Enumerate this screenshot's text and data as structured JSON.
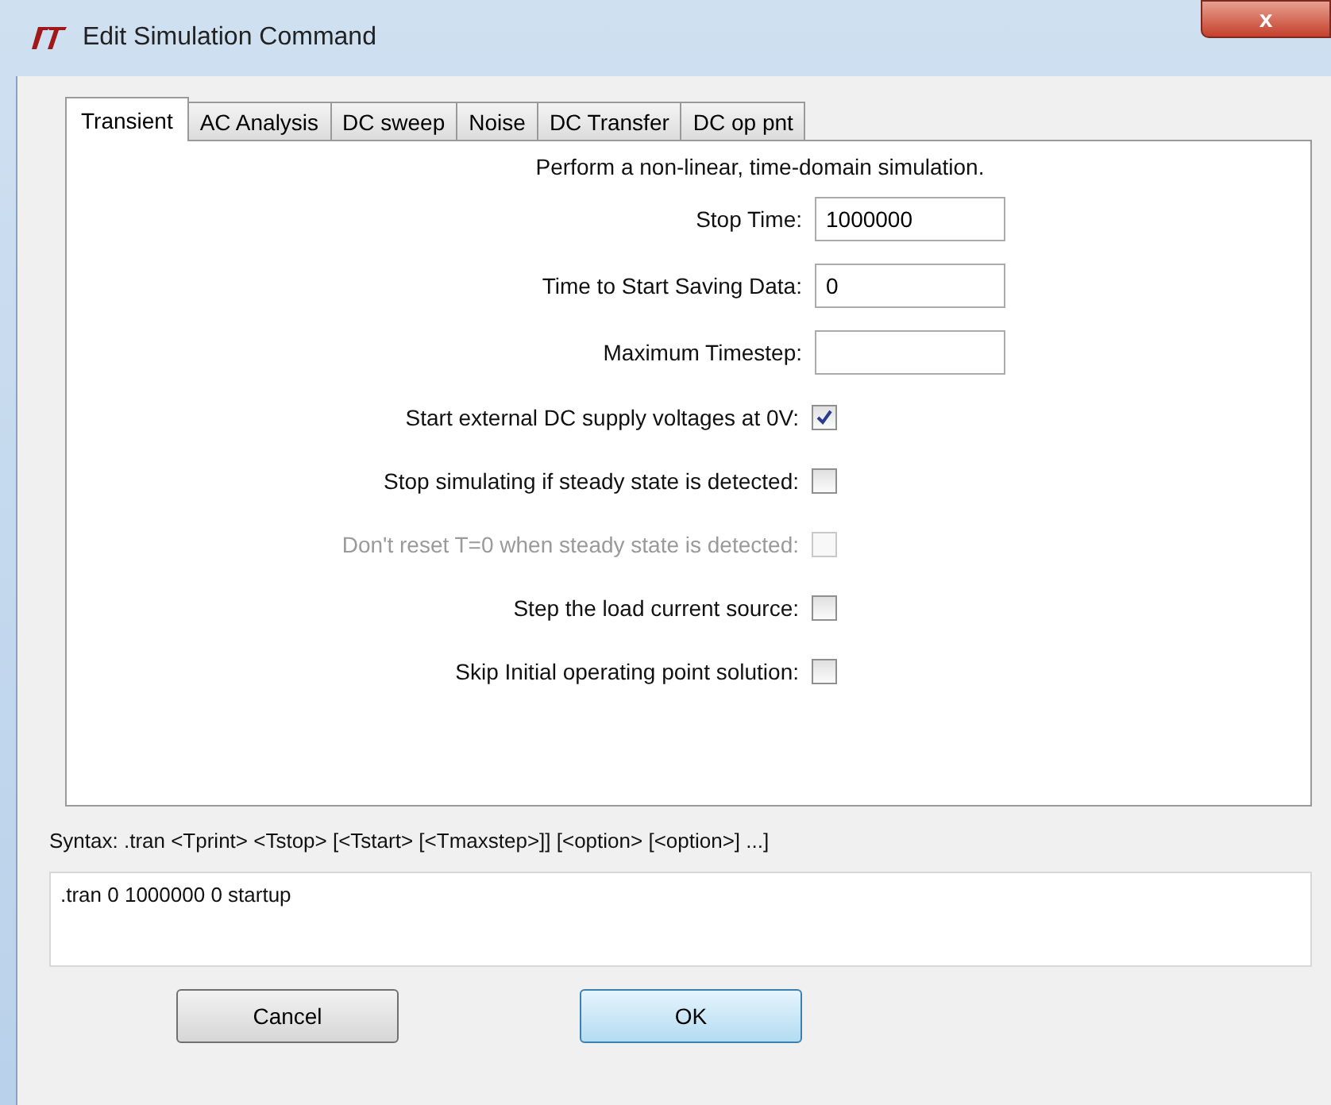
{
  "window": {
    "title": "Edit Simulation Command",
    "close": "x"
  },
  "tabs": [
    {
      "label": "Transient",
      "selected": true
    },
    {
      "label": "AC Analysis",
      "selected": false
    },
    {
      "label": "DC sweep",
      "selected": false
    },
    {
      "label": "Noise",
      "selected": false
    },
    {
      "label": "DC Transfer",
      "selected": false
    },
    {
      "label": "DC op pnt",
      "selected": false
    }
  ],
  "description": "Perform a non-linear, time-domain simulation.",
  "fields": [
    {
      "label": "Stop Time:",
      "value": "1000000"
    },
    {
      "label": "Time to Start Saving Data:",
      "value": "0"
    },
    {
      "label": "Maximum Timestep:"
    }
  ],
  "options": [
    {
      "label": "Start external DC supply voltages at 0V:",
      "checked": true,
      "disabled": false
    },
    {
      "label": "Stop simulating if steady state is detected:",
      "checked": false,
      "disabled": false
    },
    {
      "label": "Don't reset T=0 when steady state is detected:",
      "checked": false,
      "disabled": true
    },
    {
      "label": "Step the load current source:",
      "checked": false,
      "disabled": false
    },
    {
      "label": "Skip Initial operating point solution:",
      "checked": false,
      "disabled": false
    }
  ],
  "syntax": "Syntax:  .tran <Tprint> <Tstop> [<Tstart> [<Tmaxstep>]] [<option> [<option>] ...]",
  "command": ".tran 0 1000000 0 startup",
  "buttons": [
    {
      "label": "Cancel",
      "default": false
    },
    {
      "label": "OK",
      "default": true
    }
  ]
}
